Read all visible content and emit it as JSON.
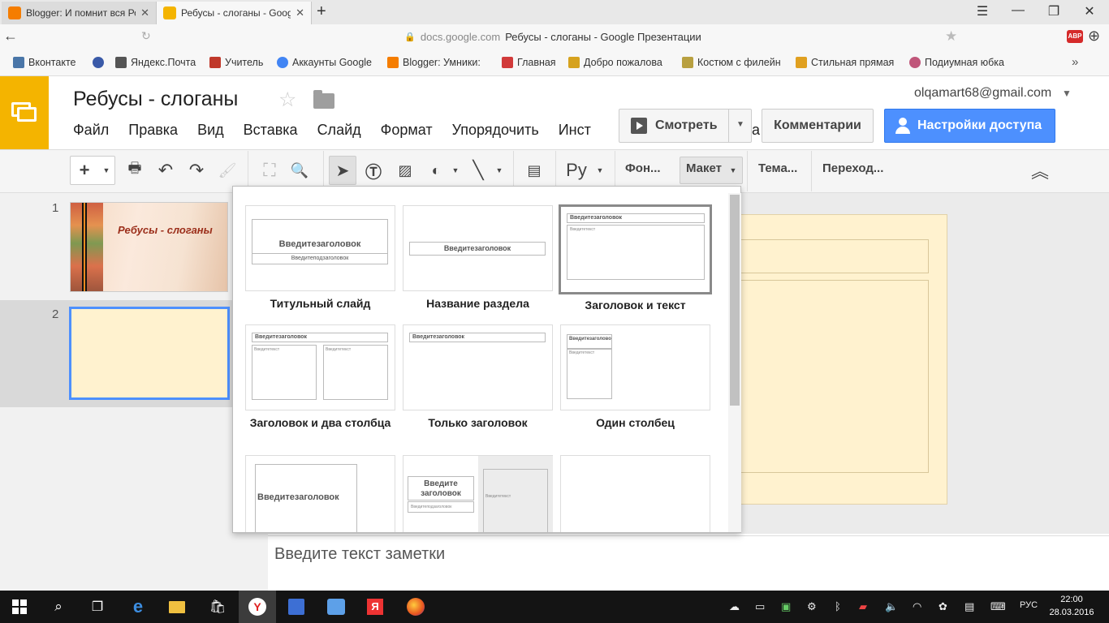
{
  "browser": {
    "tabs": [
      {
        "label": "Blogger: И помнит вся Росси",
        "color": "#f57d00"
      },
      {
        "label": "Ребусы - слоганы - Goog",
        "color": "#f4b400"
      }
    ],
    "url_domain": "docs.google.com",
    "url_title": "Ребусы - слоганы - Google Презентации",
    "adblock_badge": "ABP",
    "bookmarks": [
      {
        "label": "Вконтакте",
        "color": "#4a76a8"
      },
      {
        "label": "",
        "color": "#3a5aa8"
      },
      {
        "label": "Яндекс.Почта",
        "color": "#555555"
      },
      {
        "label": "Учитель",
        "color": "#c0392b"
      },
      {
        "label": "Аккаунты Google",
        "color": "#4285f4"
      },
      {
        "label": "Blogger: Умники:",
        "color": "#f57d00"
      },
      {
        "label": "Главная",
        "color": "#d13a3a"
      },
      {
        "label": "Добро пожалова",
        "color": "#d6a21e"
      },
      {
        "label": "Костюм с филейн",
        "color": "#b8a040"
      },
      {
        "label": "Стильная прямая",
        "color": "#e0a020"
      },
      {
        "label": "Подиумная юбка",
        "color": "#c0567a"
      }
    ]
  },
  "docs": {
    "title": "Ребусы - слоганы",
    "account": "olqamart68@gmail.com",
    "menu": [
      "Файл",
      "Правка",
      "Вид",
      "Вставка",
      "Слайд",
      "Формат",
      "Упорядочить",
      "Инст",
      "а"
    ],
    "present_label": "Смотреть",
    "comments_label": "Комментарии",
    "share_label": "Настройки доступа"
  },
  "toolbar": {
    "text_lang": "Ру",
    "background": "Фон...",
    "layout": "Макет",
    "theme": "Тема...",
    "transition": "Переход..."
  },
  "slides": {
    "numbers": [
      "1",
      "2"
    ],
    "slide1_title": "Ребусы - слоганы"
  },
  "layouts": {
    "title_placeholder": "Введитезаголовок",
    "subtitle_placeholder": "Введитеподзаголовок",
    "text_placeholder": "Введитетекст",
    "two_line_title": [
      "Введите",
      "заголовок"
    ],
    "items": [
      "Титульный слайд",
      "Название раздела",
      "Заголовок и текст",
      "Заголовок и два столбца",
      "Только заголовок",
      "Один столбец"
    ]
  },
  "notes_placeholder": "Введите текст заметки",
  "taskbar": {
    "lang": "РУС",
    "time": "22:00",
    "date": "28.03.2016"
  }
}
